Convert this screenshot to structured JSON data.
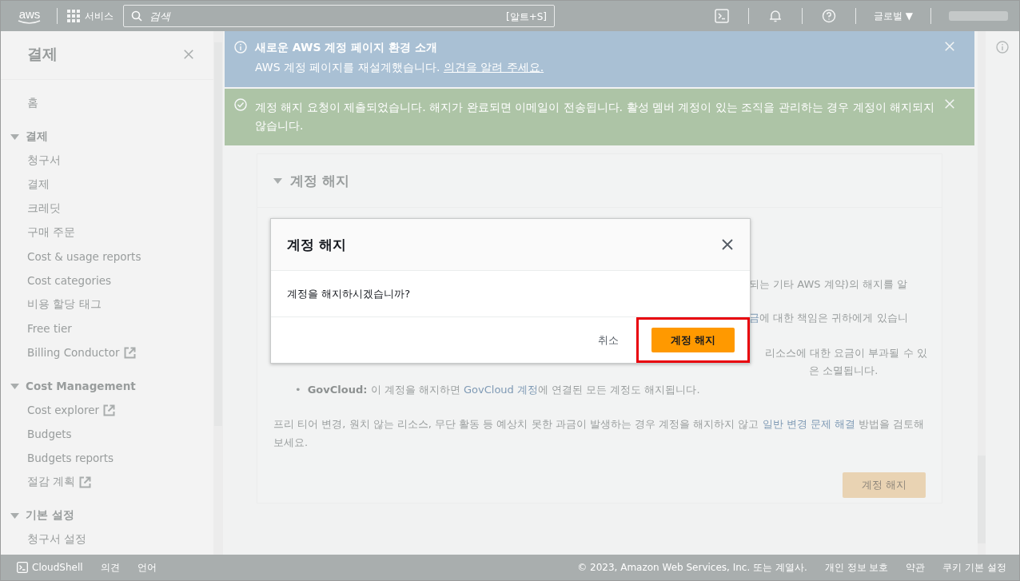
{
  "top_bar": {
    "logo": "aws",
    "services_label": "서비스",
    "search": {
      "placeholder": "검색",
      "shortcut": "[알트+S]"
    },
    "region_label": "글로벌",
    "region_caret": "▼"
  },
  "sidebar": {
    "title": "결제",
    "items": [
      {
        "label": "홈"
      }
    ],
    "sections": [
      {
        "title": "결제",
        "expanded": true,
        "items": [
          {
            "label": "청구서",
            "external": false
          },
          {
            "label": "결제",
            "external": false
          },
          {
            "label": "크레딧",
            "external": false
          },
          {
            "label": "구매 주문",
            "external": false
          },
          {
            "label": "Cost & usage reports",
            "external": false
          },
          {
            "label": "Cost categories",
            "external": false
          },
          {
            "label": "비용 할당 태그",
            "external": false
          },
          {
            "label": "Free tier",
            "external": false
          },
          {
            "label": "Billing Conductor",
            "external": true
          }
        ]
      },
      {
        "title": "Cost Management",
        "expanded": true,
        "items": [
          {
            "label": "Cost explorer",
            "external": true
          },
          {
            "label": "Budgets",
            "external": false
          },
          {
            "label": "Budgets reports",
            "external": false
          },
          {
            "label": "절감 계획",
            "external": true
          }
        ]
      },
      {
        "title": "기본 설정",
        "expanded": true,
        "items": [
          {
            "label": "청구서 설정",
            "external": false
          }
        ]
      }
    ]
  },
  "banners": [
    {
      "kind": "info",
      "title": "새로운 AWS 계정 페이지 환경 소개",
      "text": "AWS 계정 페이지를 재설계했습니다.",
      "link": "의견을 알려 주세요."
    },
    {
      "kind": "success",
      "text": "계정 해지 요청이 제출되었습니다. 해지가 완료되면 이메일이 전송됩니다. 활성 멤버 계정이 있는 조직을 관리하는 경우 계정이 해지되지 않습니다."
    }
  ],
  "panel": {
    "title": "계정 해지",
    "expanded": true,
    "fragments": [
      [
        {
          "kind": "text",
          "text": "되는 기타 AWS 계약)의 해지를 알"
        }
      ],
      [
        {
          "kind": "link",
          "text": "금"
        },
        {
          "kind": "text",
          "text": "에 대한 책임은 귀하에게 있습니"
        }
      ],
      [
        {
          "kind": "text",
          "text": "리소스에 대한 요금이 부과될 수 있"
        }
      ],
      [
        {
          "kind": "text",
          "text": "은 소멸됩니다."
        }
      ]
    ],
    "bullets": [
      {
        "marker": "•",
        "segments": [
          {
            "kind": "bold",
            "text": "GovCloud:"
          },
          {
            "kind": "text",
            "text": " 이 계정을 해지하면 "
          },
          {
            "kind": "link",
            "text": "GovCloud 계정"
          },
          {
            "kind": "text",
            "text": "에 연결된 모든 계정도 해지됩니다."
          }
        ]
      }
    ],
    "paragraph": [
      {
        "kind": "text",
        "text": "프리 티어 변경, 원치 않는 리소스, 무단 활동 등 예상치 못한 과금이 발생하는 경우 계정을 해지하지 않고 "
      },
      {
        "kind": "link",
        "text": "일반 변경 문제 해결"
      },
      {
        "kind": "text",
        "text": " 방법을 검토해 보세요."
      }
    ],
    "button": "계정 해지"
  },
  "modal": {
    "title": "계정 해지",
    "message": "계정을 해지하시겠습니까?",
    "cancel": "취소",
    "confirm": "계정 해지",
    "highlighted": true
  },
  "footer": {
    "left": [
      "CloudShell",
      "의견",
      "언어"
    ],
    "copyright": "© 2023, Amazon Web Services, Inc. 또는 계열사.",
    "right": [
      "개인 정보 보호",
      "약관",
      "쿠키 기본 설정"
    ]
  }
}
